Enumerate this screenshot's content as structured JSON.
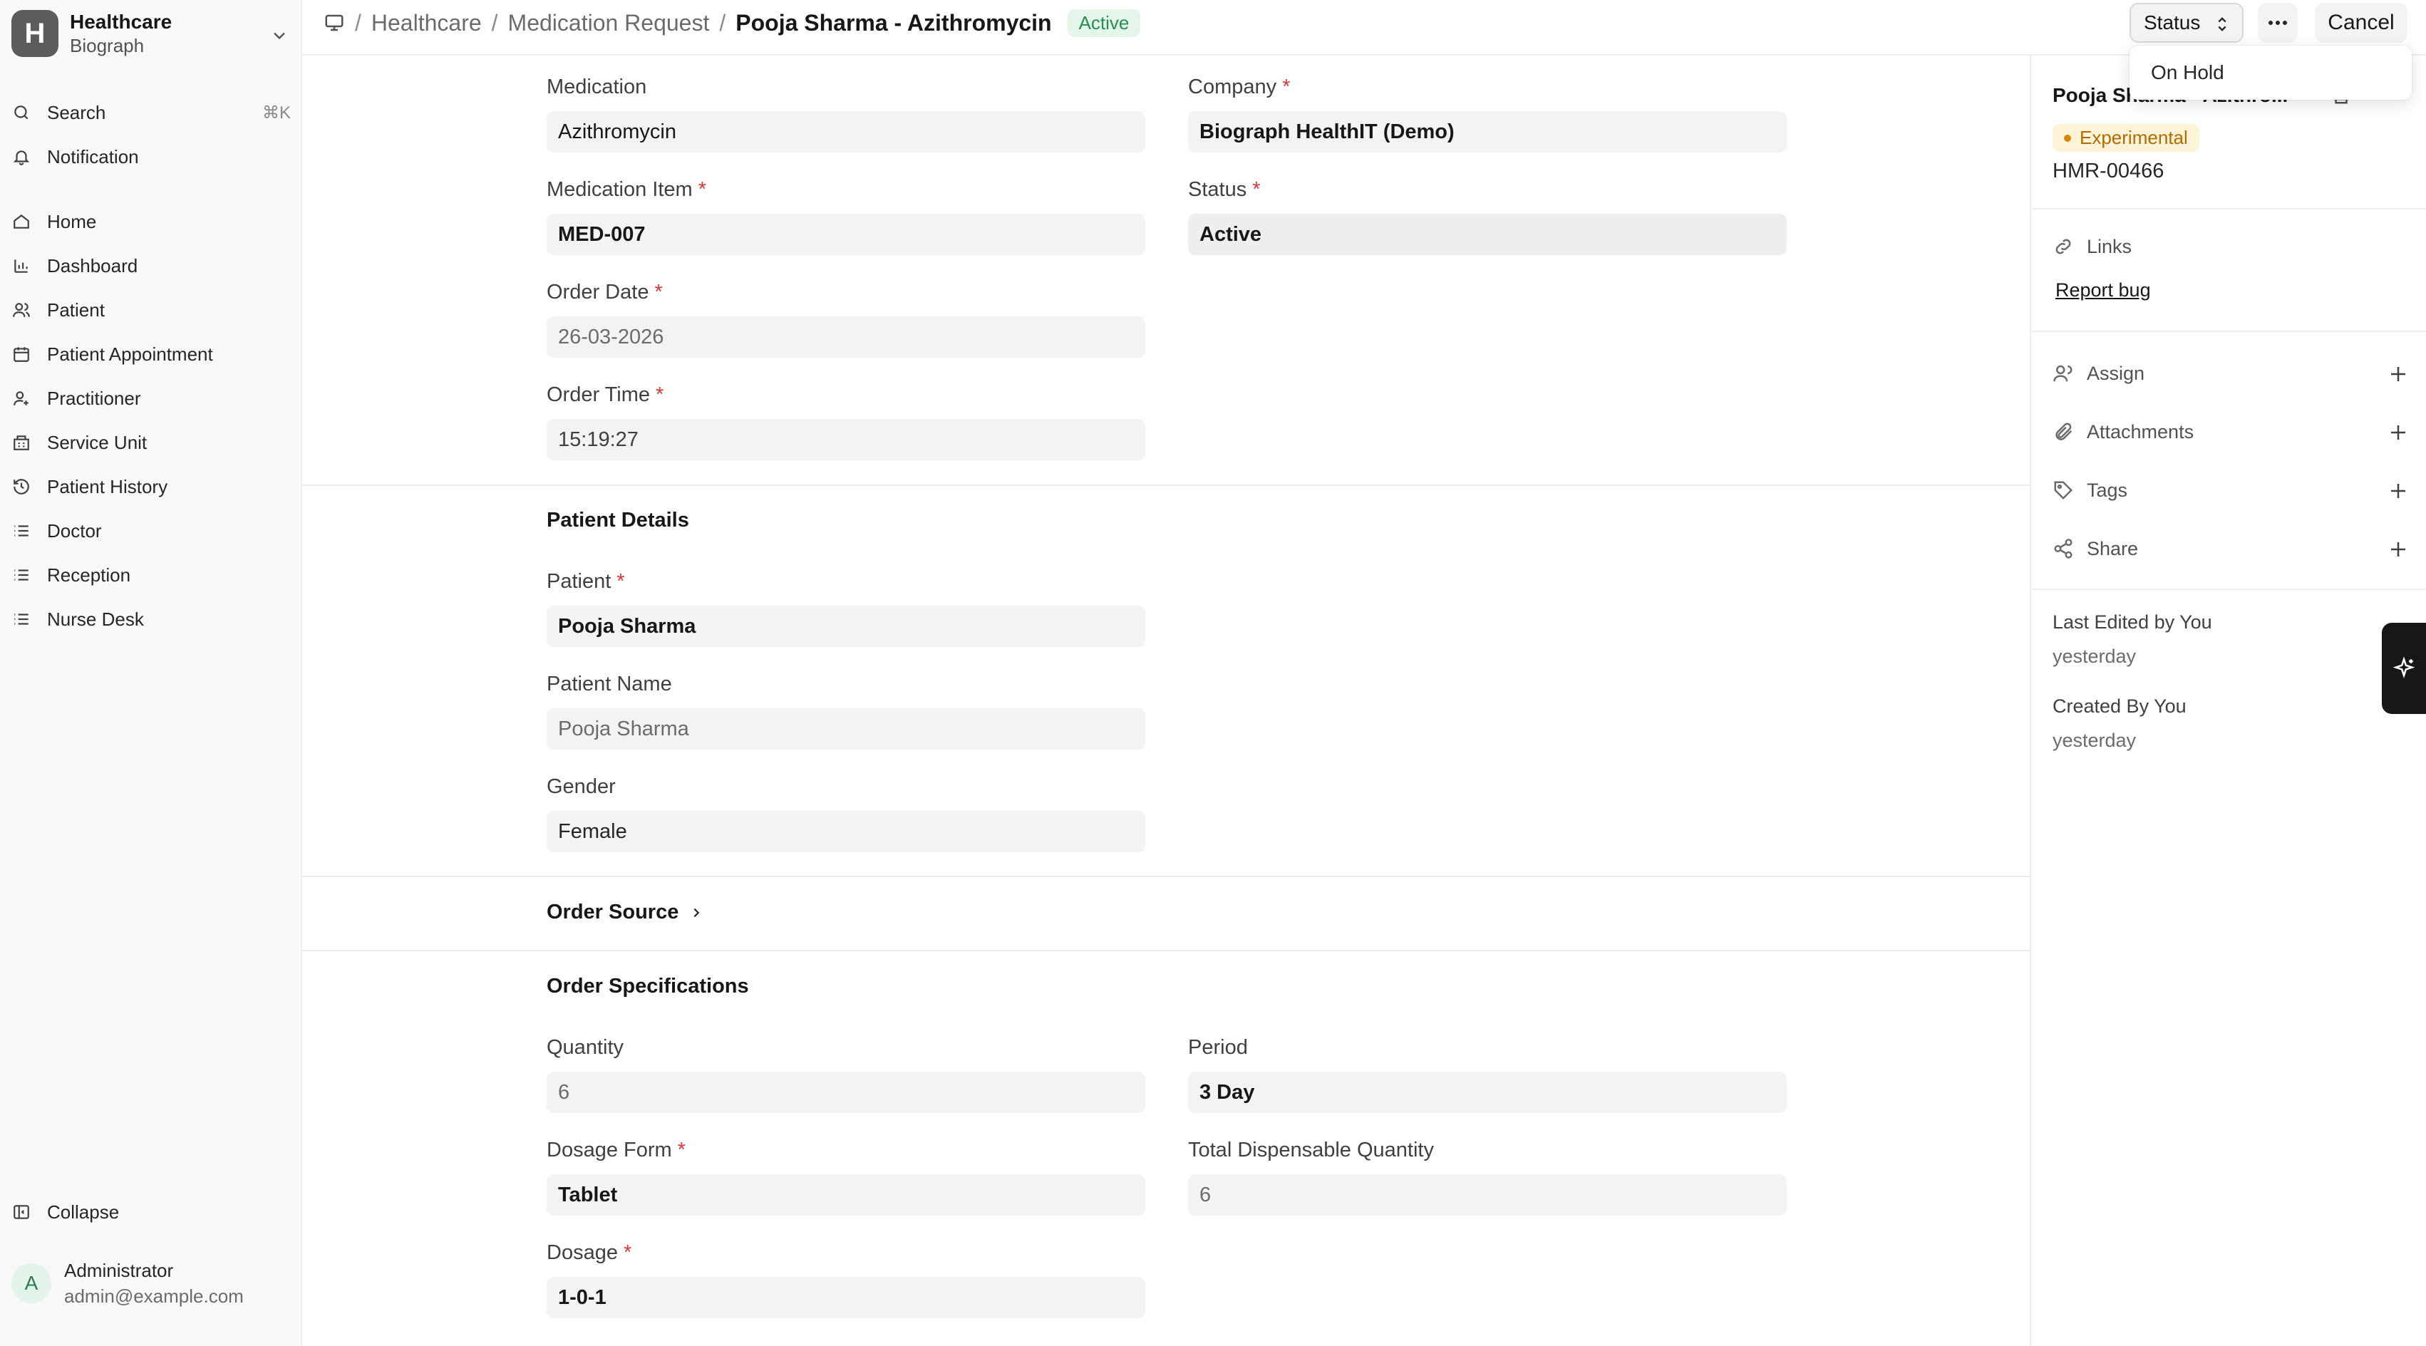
{
  "sidebar": {
    "brand": {
      "logo_letter": "H",
      "title": "Healthcare",
      "subtitle": "Biograph"
    },
    "search": {
      "label": "Search",
      "shortcut": "⌘K"
    },
    "notification": {
      "label": "Notification"
    },
    "items": [
      {
        "label": "Home",
        "icon": "home-icon"
      },
      {
        "label": "Dashboard",
        "icon": "bar-chart-icon"
      },
      {
        "label": "Patient",
        "icon": "users-icon"
      },
      {
        "label": "Patient Appointment",
        "icon": "calendar-icon"
      },
      {
        "label": "Practitioner",
        "icon": "user-plus-icon"
      },
      {
        "label": "Service Unit",
        "icon": "building-icon"
      },
      {
        "label": "Patient History",
        "icon": "history-icon"
      },
      {
        "label": "Doctor",
        "icon": "list-icon"
      },
      {
        "label": "Reception",
        "icon": "list-icon"
      },
      {
        "label": "Nurse Desk",
        "icon": "list-icon"
      }
    ],
    "collapse": {
      "label": "Collapse"
    },
    "user": {
      "initial": "A",
      "name": "Administrator",
      "email": "admin@example.com"
    }
  },
  "topbar": {
    "breadcrumbs": [
      "Healthcare",
      "Medication Request",
      "Pooja Sharma - Azithromycin"
    ],
    "status_badge": "Active",
    "status_button": "Status",
    "cancel_button": "Cancel",
    "dropdown": {
      "items": [
        "On Hold"
      ]
    }
  },
  "form": {
    "medication": {
      "label": "Medication",
      "value": "Azithromycin"
    },
    "company": {
      "label": "Company",
      "value": "Biograph HealthIT (Demo)"
    },
    "medication_item": {
      "label": "Medication Item",
      "value": "MED-007"
    },
    "status": {
      "label": "Status",
      "value": "Active"
    },
    "order_date": {
      "label": "Order Date",
      "value": "26-03-2026"
    },
    "order_time": {
      "label": "Order Time",
      "value": "15:19:27"
    },
    "patient_details_title": "Patient Details",
    "patient": {
      "label": "Patient",
      "value": "Pooja Sharma"
    },
    "patient_name": {
      "label": "Patient Name",
      "value": "Pooja Sharma"
    },
    "gender": {
      "label": "Gender",
      "value": "Female"
    },
    "order_source_title": "Order Source",
    "order_specs_title": "Order Specifications",
    "quantity": {
      "label": "Quantity",
      "value": "6"
    },
    "period": {
      "label": "Period",
      "value": "3 Day"
    },
    "dosage_form": {
      "label": "Dosage Form",
      "value": "Tablet"
    },
    "total_dispensable": {
      "label": "Total Dispensable Quantity",
      "value": "6"
    },
    "dosage": {
      "label": "Dosage",
      "value": "1-0-1"
    },
    "required_mark": "*"
  },
  "right_panel": {
    "title": "Pooja Sharma - Azithro...",
    "tag": "Experimental",
    "doc_id": "HMR-00466",
    "links_label": "Links",
    "report_bug": "Report bug",
    "actions": [
      {
        "label": "Assign",
        "icon": "user-icon"
      },
      {
        "label": "Attachments",
        "icon": "paperclip-icon"
      },
      {
        "label": "Tags",
        "icon": "tag-icon"
      },
      {
        "label": "Share",
        "icon": "share-icon"
      }
    ],
    "last_edited": {
      "label": "Last Edited by You",
      "time": "yesterday"
    },
    "created": {
      "label": "Created By You",
      "time": "yesterday"
    }
  },
  "colors": {
    "accent_green": "#278f50",
    "required_red": "#e03636",
    "tag_amber": "#b36a00",
    "sidebar_bg": "#f8f8f8",
    "input_bg": "#f3f3f3"
  }
}
